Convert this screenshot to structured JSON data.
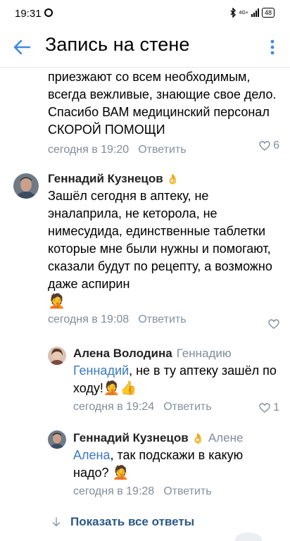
{
  "status": {
    "time": "19:31",
    "network": "4G+",
    "battery": "48"
  },
  "header": {
    "title": "Запись на стене"
  },
  "comments": {
    "c1": {
      "text": "приезжают со всем необходимым, всегда вежливые, знающие свое дело. Спасибо ВАМ медицинский персонал СКОРОЙ ПОМОЩИ",
      "date": "сегодня в 19:20",
      "reply": "Ответить",
      "likes": "6"
    },
    "c2": {
      "author": "Геннадий Кузнецов",
      "author_emoji": "👌",
      "text": "Зашёл сегодня в аптеку, не эналаприла, не кеторола, не нимесудида, единственные таблетки которые мне были нужны и помогают, сказали будут по рецепту, а возможно даже аспирин",
      "text_emoji": "🤦",
      "date": "сегодня в 19:08",
      "reply": "Ответить"
    },
    "c3": {
      "author": "Алена Володина",
      "reply_to": "Геннадию",
      "mention": "Геннадий",
      "text": ", не в ту аптеку зашёл по ходу!",
      "text_emoji": "🤦👍",
      "date": "сегодня в 19:24",
      "reply": "Ответить",
      "likes": "1"
    },
    "c4": {
      "author": "Геннадий Кузнецов",
      "author_emoji": "👌",
      "reply_to": "Алене",
      "mention": "Алена",
      "text": ", так подскажи в какую надо?",
      "text_emoji": "🤦",
      "date": "сегодня в 19:28",
      "reply": "Ответить"
    }
  },
  "show_all": "Показать все ответы",
  "colors": {
    "link": "#2a5885",
    "accent": "#3f8ae0",
    "meta": "#818c99"
  }
}
